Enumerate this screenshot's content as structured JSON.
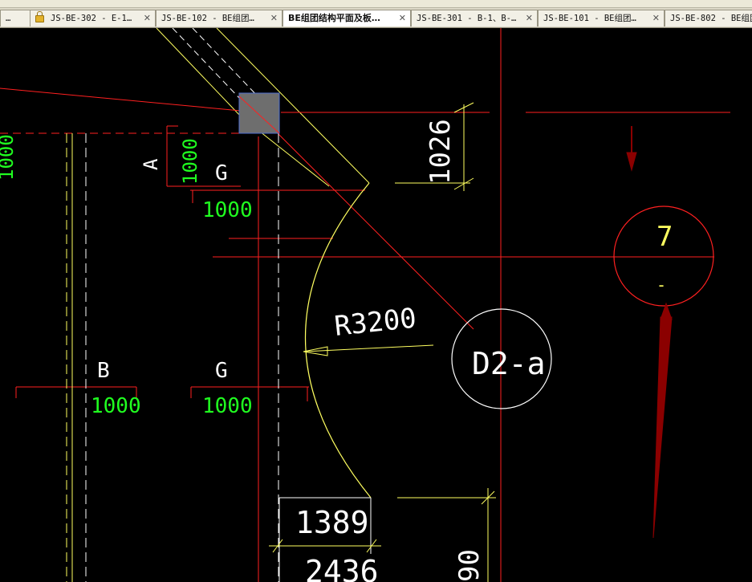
{
  "tabs": [
    {
      "label": "…"
    },
    {
      "label": "JS-BE-302 - E-1…",
      "locked": true
    },
    {
      "label": "JS-BE-102 - BE组团…"
    },
    {
      "label": "BE组团结构平面及板…",
      "active": true
    },
    {
      "label": "JS-BE-301 - B-1、B-…"
    },
    {
      "label": "JS-BE-101 - BE组团…"
    },
    {
      "label": "JS-BE-802 - BE组团…"
    }
  ],
  "drawing": {
    "dim_1026": "1026",
    "label_A": "A",
    "dim_A_1000": "1000",
    "label_G_top": "G",
    "dim_G_top_1000": "1000",
    "left_edge_1000": "1000",
    "radius_label": "R3200",
    "circle_label": "D2-a",
    "section_top": "7",
    "section_bottom": "-",
    "label_B": "B",
    "dim_B_1000": "1000",
    "label_G_bottom": "G",
    "dim_G_bottom_1000": "1000",
    "dim_1389": "1389",
    "dim_2436": "2436",
    "dim_90": "90"
  },
  "colors": {
    "background": "#000000",
    "red": "#ff2020",
    "yellow": "#ffff60",
    "white": "#ffffff",
    "green": "#20ff20",
    "dark_red": "#8b0000",
    "gray_fill": "#6e6e6e",
    "blue": "#4f6fd0"
  }
}
